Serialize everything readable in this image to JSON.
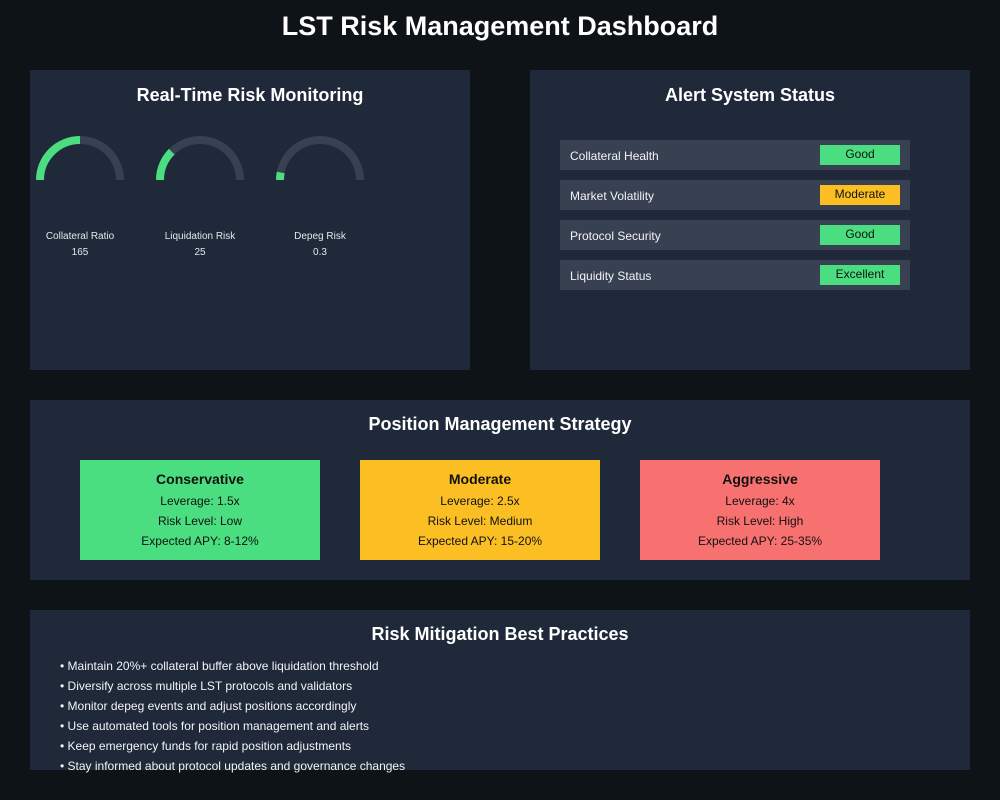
{
  "title": "LST Risk Management Dashboard",
  "colors": {
    "background": "#0e1317",
    "panel": "#1f293a",
    "row": "#374151",
    "good": "#4ade80",
    "moderate": "#fbbf24",
    "high": "#f87171",
    "gauge_track": "#374151"
  },
  "monitoring": {
    "title": "Real-Time Risk Monitoring",
    "gauges": [
      {
        "label": "Collateral Ratio",
        "value": "165",
        "fill_fraction": 0.5,
        "color": "#4ade80"
      },
      {
        "label": "Liquidation Risk",
        "value": "25",
        "fill_fraction": 0.25,
        "color": "#4ade80"
      },
      {
        "label": "Depeg Risk",
        "value": "0.3",
        "fill_fraction": 0.06,
        "color": "#4ade80"
      }
    ]
  },
  "alerts": {
    "title": "Alert System Status",
    "items": [
      {
        "label": "Collateral Health",
        "status": "Good",
        "color": "#4ade80"
      },
      {
        "label": "Market Volatility",
        "status": "Moderate",
        "color": "#fbbf24"
      },
      {
        "label": "Protocol Security",
        "status": "Good",
        "color": "#4ade80"
      },
      {
        "label": "Liquidity Status",
        "status": "Excellent",
        "color": "#4ade80"
      }
    ]
  },
  "strategy": {
    "title": "Position Management Strategy",
    "cards": [
      {
        "name": "Conservative",
        "leverage": "Leverage: 1.5x",
        "risk": "Risk Level: Low",
        "apy": "Expected APY: 8-12%",
        "color": "#4ade80"
      },
      {
        "name": "Moderate",
        "leverage": "Leverage: 2.5x",
        "risk": "Risk Level: Medium",
        "apy": "Expected APY: 15-20%",
        "color": "#fbbf24"
      },
      {
        "name": "Aggressive",
        "leverage": "Leverage: 4x",
        "risk": "Risk Level: High",
        "apy": "Expected APY: 25-35%",
        "color": "#f87171"
      }
    ]
  },
  "practices": {
    "title": "Risk Mitigation Best Practices",
    "items": [
      "• Maintain 20%+ collateral buffer above liquidation threshold",
      "• Diversify across multiple LST protocols and validators",
      "• Monitor depeg events and adjust positions accordingly",
      "• Use automated tools for position management and alerts",
      "• Keep emergency funds for rapid position adjustments",
      "• Stay informed about protocol updates and governance changes"
    ]
  }
}
